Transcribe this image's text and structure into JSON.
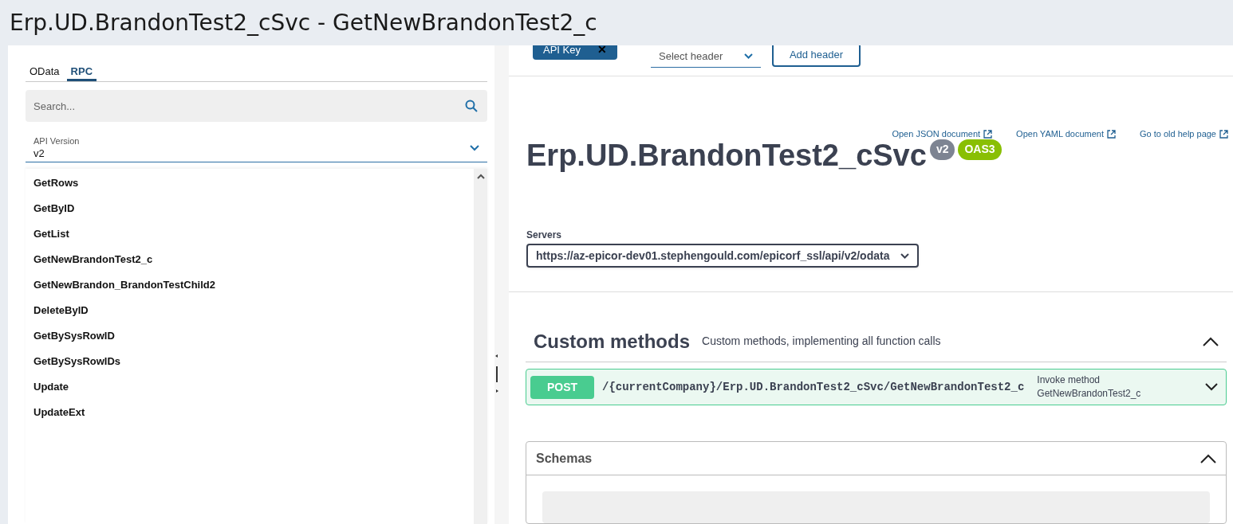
{
  "window": {
    "title": "Erp.UD.BrandonTest2_cSvc - GetNewBrandonTest2_c"
  },
  "sidebar": {
    "tabs": [
      {
        "label": "OData",
        "selected": false
      },
      {
        "label": "RPC",
        "selected": true
      }
    ],
    "search": {
      "placeholder": "Search..."
    },
    "api_version": {
      "label": "API Version",
      "value": "v2"
    },
    "methods": [
      "GetRows",
      "GetByID",
      "GetList",
      "GetNewBrandonTest2_c",
      "GetNewBrandon_BrandonTestChild2",
      "DeleteByID",
      "GetBySysRowID",
      "GetBySysRowIDs",
      "Update",
      "UpdateExt"
    ]
  },
  "auth": {
    "chip": "API Key",
    "chip_close": "✕",
    "header_select": {
      "placeholder": "Select header"
    },
    "add_button": "Add header"
  },
  "info": {
    "links": [
      "Open JSON document",
      "Open YAML document",
      "Go to old help page"
    ],
    "title": "Erp.UD.BrandonTest2_cSvc",
    "badges": [
      {
        "label": "v2",
        "color": "#7d8492"
      },
      {
        "label": "OAS3",
        "color": "#89bf04"
      }
    ]
  },
  "servers": {
    "label": "Servers",
    "value": "https://az-epicor-dev01.stephengould.com/epicorf_ssl/api/v2/odata"
  },
  "sections": [
    {
      "title": "Custom methods",
      "description": "Custom methods, implementing all function calls",
      "expanded": true,
      "operations": [
        {
          "method": "POST",
          "path": "/{currentCompany}/Erp.UD.BrandonTest2_cSvc/GetNewBrandonTest2_c",
          "summary": "Invoke method GetNewBrandonTest2_c",
          "expanded": false
        }
      ]
    }
  ],
  "schemas": {
    "title": "Schemas",
    "expanded": true
  }
}
